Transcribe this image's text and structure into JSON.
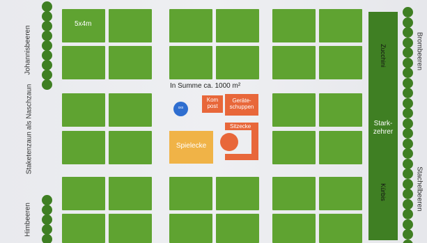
{
  "title": "In Summe ca. 1000 m²",
  "plot_label": "5x4m",
  "left_labels": {
    "top": "Johannisbeeren",
    "middle": "Staketenzaun als Naschzaun",
    "bottom": "Himbeeren"
  },
  "right_labels": {
    "top": "Brombeeren",
    "bottom": "Stachelbeeren"
  },
  "tall_bed": {
    "top": "Zucchini",
    "middle": "Stark-\nzehrer",
    "bottom": "Kürbis"
  },
  "features": {
    "kompost": "Kom\npost",
    "geraeteschuppen": "Geräte-\nschuppen",
    "sitzecke": "Sitzecke",
    "spielecke": "Spielecke",
    "circle_small": "xxx"
  },
  "colors": {
    "bed": "#5fa331",
    "hedge": "#3f7f23",
    "orange": "#e8673a",
    "sandbox": "#f0b347",
    "blue": "#2f6ed0"
  }
}
